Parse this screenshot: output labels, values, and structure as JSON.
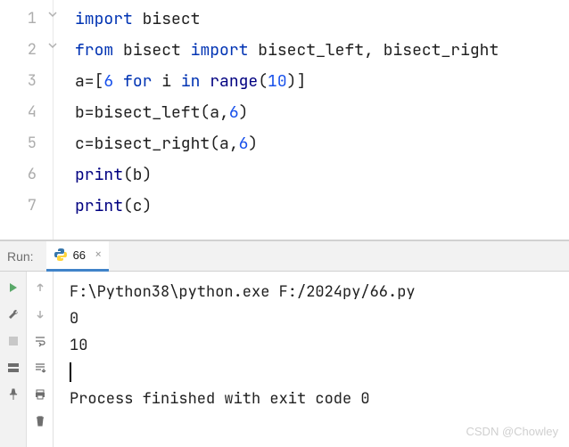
{
  "editor": {
    "lines": [
      "1",
      "2",
      "3",
      "4",
      "5",
      "6",
      "7"
    ],
    "code": {
      "l1": {
        "import": "import",
        "mod": "bisect"
      },
      "l2": {
        "from": "from",
        "mod": "bisect",
        "import": "import",
        "n1": "bisect_left",
        "comma": ", ",
        "n2": "bisect_right"
      },
      "l3": {
        "var": "a=[",
        "num1": "6",
        "for": " for ",
        "i": "i",
        "in": " in ",
        "range": "range",
        "p1": "(",
        "num2": "10",
        "p2": ")]"
      },
      "l4": {
        "var": "b=bisect_left(a,",
        "num": "6",
        "end": ")"
      },
      "l5": {
        "var": "c=bisect_right(a,",
        "num": "6",
        "end": ")"
      },
      "l6": {
        "print": "print",
        "arg": "(b)"
      },
      "l7": {
        "print": "print",
        "arg": "(c)"
      }
    }
  },
  "run": {
    "label": "Run:",
    "tab_name": "66",
    "output": {
      "o1": "F:\\Python38\\python.exe F:/2024py/66.py",
      "o2": "0",
      "o3": "10",
      "o4": "",
      "o5": "Process finished with exit code 0"
    }
  },
  "watermark": "CSDN @Chowley"
}
